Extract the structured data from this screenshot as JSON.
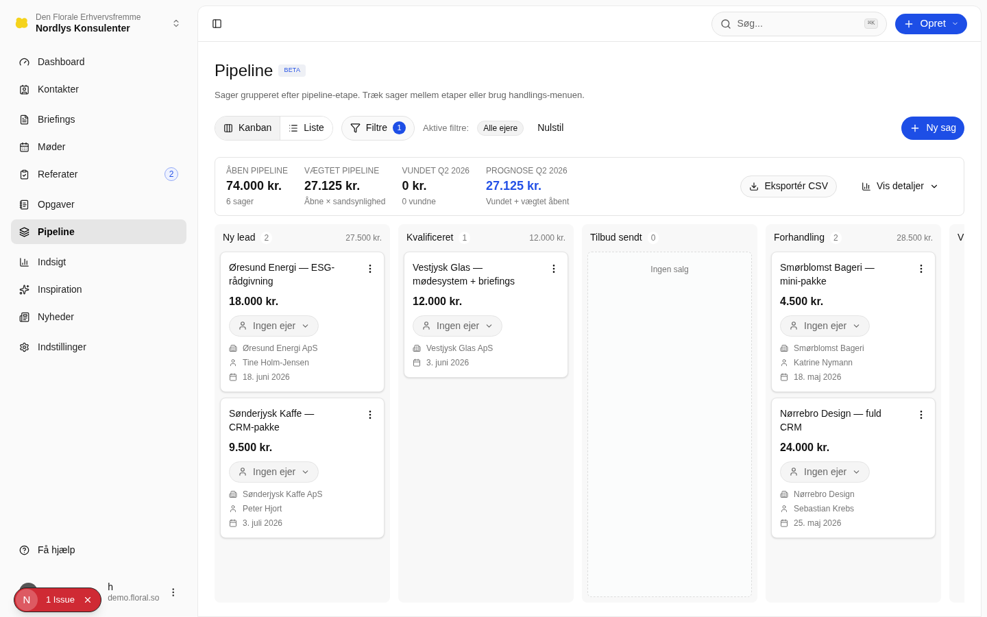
{
  "workspace": {
    "org": "Den Florale Erhvervsfremme",
    "name": "Nordlys Konsulenter"
  },
  "sidebar": {
    "groups": [
      [
        {
          "label": "Dashboard",
          "selected": false
        },
        {
          "label": "Kontakter",
          "selected": false
        }
      ],
      [
        {
          "label": "Briefings",
          "selected": false
        },
        {
          "label": "Møder",
          "selected": false
        },
        {
          "label": "Referater",
          "selected": false,
          "badge": "2"
        }
      ],
      [
        {
          "label": "Opgaver",
          "selected": false
        },
        {
          "label": "Pipeline",
          "selected": true
        }
      ],
      [
        {
          "label": "Indsigt",
          "selected": false
        },
        {
          "label": "Inspiration",
          "selected": false
        },
        {
          "label": "Nyheder",
          "selected": false
        }
      ],
      [
        {
          "label": "Indstillinger",
          "selected": false
        }
      ]
    ],
    "help": "Få hjælp",
    "user": {
      "name": "h",
      "email": "demo.floral.so"
    }
  },
  "issue_toast": {
    "letter": "N",
    "label": "1 Issue"
  },
  "topbar": {
    "search_placeholder": "Søg...",
    "shortcut": "⌘K",
    "create": "Opret"
  },
  "page": {
    "title": "Pipeline",
    "badge": "BETA",
    "subtitle": "Sager grupperet efter pipeline-etape. Træk sager mellem etaper eller brug handlings-menuen."
  },
  "views": [
    {
      "label": "Kanban",
      "selected": true
    },
    {
      "label": "Liste",
      "selected": false
    }
  ],
  "filters": {
    "label": "Filtre",
    "count": "1",
    "active_label": "Aktive filtre:",
    "chips": [
      "Alle ejere"
    ],
    "reset": "Nulstil"
  },
  "new_case": "Ny sag",
  "stats": [
    {
      "label": "ÅBEN PIPELINE",
      "value": "74.000 kr.",
      "sub": "6 sager",
      "highlight": false
    },
    {
      "label": "VÆGTET PIPELINE",
      "value": "27.125 kr.",
      "sub": "Åbne × sandsynlighed",
      "highlight": false
    },
    {
      "label": "VUNDET Q2 2026",
      "value": "0 kr.",
      "sub": "0 vundne",
      "highlight": false
    },
    {
      "label": "PROGNOSE Q2 2026",
      "value": "27.125 kr.",
      "sub": "Vundet + vægtet åbent",
      "highlight": true
    }
  ],
  "export": "Eksportér CSV",
  "details": "Vis detaljer",
  "columns": [
    {
      "title": "Ny lead",
      "count": "2",
      "total": "27.500 kr.",
      "cards": [
        {
          "title": "Øresund Energi — ESG-rådgivning",
          "amount": "18.000 kr.",
          "owner": "Ingen ejer",
          "company": "Øresund Energi ApS",
          "contact": "Tine Holm-Jensen",
          "date": "18. juni 2026"
        },
        {
          "title": "Sønderjysk Kaffe — CRM-pakke",
          "amount": "9.500 kr.",
          "owner": "Ingen ejer",
          "company": "Sønderjysk Kaffe ApS",
          "contact": "Peter Hjort",
          "date": "3. juli 2026"
        }
      ]
    },
    {
      "title": "Kvalificeret",
      "count": "1",
      "total": "12.000 kr.",
      "cards": [
        {
          "title": "Vestjysk Glas — mødesystem + briefings",
          "amount": "12.000 kr.",
          "owner": "Ingen ejer",
          "company": "Vestjysk Glas ApS",
          "date": "3. juni 2026"
        }
      ]
    },
    {
      "title": "Tilbud sendt",
      "count": "0",
      "empty": "Ingen salg"
    },
    {
      "title": "Forhandling",
      "count": "2",
      "total": "28.500 kr.",
      "cards": [
        {
          "title": "Smørblomst Bageri — mini-pakke",
          "amount": "4.500 kr.",
          "owner": "Ingen ejer",
          "company": "Smørblomst Bageri",
          "contact": "Katrine Nymann",
          "date": "18. maj 2026"
        },
        {
          "title": "Nørrebro Design — fuld CRM",
          "amount": "24.000 kr.",
          "owner": "Ingen ejer",
          "company": "Nørrebro Design",
          "contact": "Sebastian Krebs",
          "date": "25. maj 2026"
        }
      ]
    },
    {
      "title": "V"
    }
  ]
}
